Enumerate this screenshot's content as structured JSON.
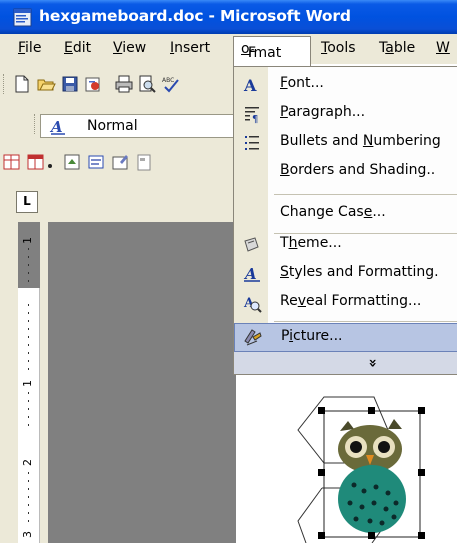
{
  "window": {
    "title": "hexgameboard.doc - Microsoft Word"
  },
  "menubar": {
    "items": [
      {
        "label": "File",
        "mnemonic": "F",
        "rest": "ile"
      },
      {
        "label": "Edit",
        "mnemonic": "E",
        "rest": "dit"
      },
      {
        "label": "View",
        "mnemonic": "V",
        "rest": "iew"
      },
      {
        "label": "Insert",
        "mnemonic": "I",
        "rest": "nsert"
      },
      {
        "label": "Format",
        "pre": "F",
        "mnemonic": "o",
        "rest": "rmat"
      },
      {
        "label": "Tools",
        "mnemonic": "T",
        "rest": "ools"
      },
      {
        "label": "Table",
        "pre": "T",
        "mnemonic": "a",
        "rest": "ble"
      },
      {
        "label": "W",
        "mnemonic": "W",
        "rest": ""
      }
    ]
  },
  "formatting_toolbar": {
    "style_value": "Normal"
  },
  "ruler": {
    "numbers": [
      "1",
      "1",
      "2",
      "3"
    ]
  },
  "format_menu": {
    "items": [
      {
        "pre": "",
        "mnemonic": "F",
        "rest": "ont...",
        "icon": "font-icon"
      },
      {
        "pre": "",
        "mnemonic": "P",
        "rest": "aragraph...",
        "icon": "paragraph-icon"
      },
      {
        "pre": "Bullets and ",
        "mnemonic": "N",
        "rest": "umbering",
        "icon": "bullets-icon"
      },
      {
        "pre": "",
        "mnemonic": "B",
        "rest": "orders and Shading..",
        "icon": ""
      },
      {
        "pre": "Change Cas",
        "mnemonic": "e",
        "rest": "...",
        "icon": ""
      },
      {
        "pre": "T",
        "mnemonic": "h",
        "rest": "eme...",
        "icon": "theme-icon"
      },
      {
        "pre": "",
        "mnemonic": "S",
        "rest": "tyles and Formatting.",
        "icon": "styles-icon"
      },
      {
        "pre": "Re",
        "mnemonic": "v",
        "rest": "eal Formatting...",
        "icon": "reveal-formatting-icon"
      },
      {
        "pre": "P",
        "mnemonic": "i",
        "rest": "cture...",
        "icon": "picture-icon"
      }
    ],
    "more_glyph": "»"
  },
  "colors": {
    "titlebar": "#0052e0",
    "menubar": "#ece9d8",
    "highlight": "#b7c5e3",
    "workspace": "#808080"
  }
}
